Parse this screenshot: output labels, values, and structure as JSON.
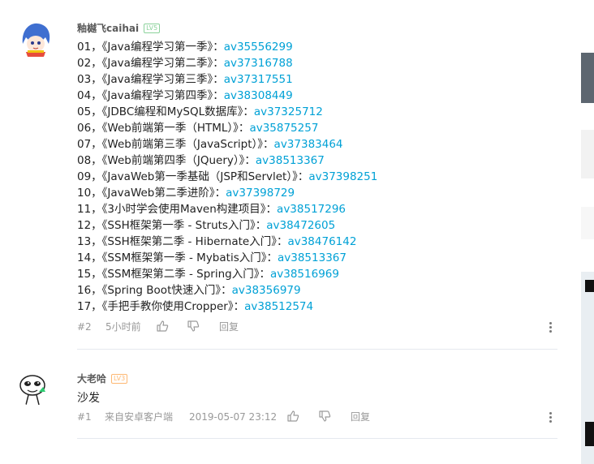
{
  "comments": [
    {
      "user": "釉樾飞caihai",
      "level": "LV5",
      "level_color": "#8bd29b",
      "lines": [
        {
          "prefix": "01，《Java编程学习第一季》：",
          "av": "av35556299"
        },
        {
          "prefix": "02，《Java编程学习第二季》：",
          "av": "av37316788"
        },
        {
          "prefix": "03，《Java编程学习第三季》：",
          "av": "av37317551"
        },
        {
          "prefix": "04，《Java编程学习第四季》：",
          "av": "av38308449"
        },
        {
          "prefix": "05，《JDBC编程和MySQL数据库》：",
          "av": "av37325712"
        },
        {
          "prefix": "06，《Web前端第一季（HTML）》：",
          "av": "av35875257"
        },
        {
          "prefix": "07，《Web前端第三季（JavaScript）》：",
          "av": "av37383464"
        },
        {
          "prefix": "08，《Web前端第四季（JQuery）》：",
          "av": "av38513367"
        },
        {
          "prefix": "09，《JavaWeb第一季基础（JSP和Servlet）》：",
          "av": "av37398251"
        },
        {
          "prefix": "10，《JavaWeb第二季进阶》：",
          "av": "av37398729"
        },
        {
          "prefix": "11，《3小时学会使用Maven构建项目》：",
          "av": "av38517296"
        },
        {
          "prefix": "12，《SSH框架第一季 - Struts入门》：",
          "av": "av38472605"
        },
        {
          "prefix": "13，《SSH框架第二季 - Hibernate入门》：",
          "av": "av38476142"
        },
        {
          "prefix": "14，《SSM框架第一季 - Mybatis入门》：",
          "av": "av38513367"
        },
        {
          "prefix": "15，《SSM框架第二季 - Spring入门》：",
          "av": "av38516969"
        },
        {
          "prefix": "16，《Spring Boot快速入门》：",
          "av": "av38356979"
        },
        {
          "prefix": "17，《手把手教你使用Cropper》：",
          "av": "av38512574"
        }
      ],
      "floor": "#2",
      "time": "5小时前",
      "reply": "回复"
    },
    {
      "user": "大老哈",
      "level": "LV3",
      "level_color": "#feb872",
      "text": "沙发",
      "floor": "#1",
      "source": "来自安卓客户端",
      "time": "2019-05-07 23:12",
      "reply": "回复"
    }
  ],
  "icons": {
    "like": "thumbs-up-icon",
    "dislike": "thumbs-down-icon",
    "more": "more-vertical-icon"
  },
  "colors": {
    "link": "#00a1d6",
    "meta": "#999999",
    "divider": "#e5e9ef"
  }
}
